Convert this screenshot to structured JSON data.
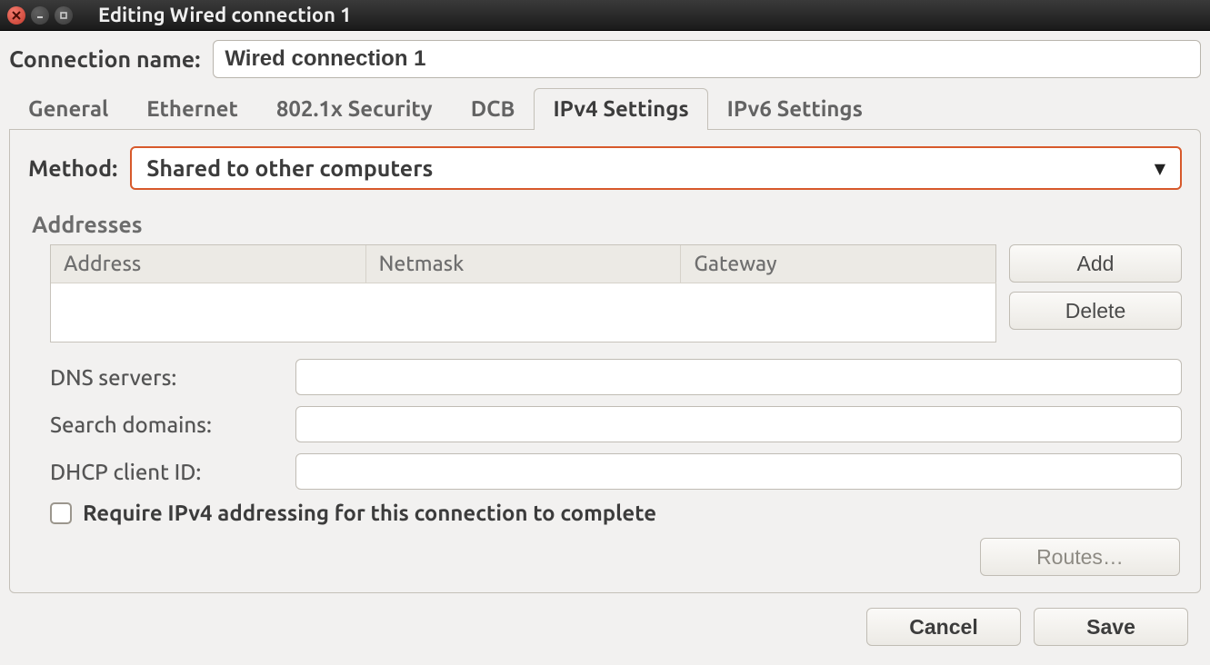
{
  "window": {
    "title": "Editing Wired connection 1"
  },
  "connection": {
    "name_label": "Connection name:",
    "name_value": "Wired connection 1"
  },
  "tabs": [
    {
      "label": "General"
    },
    {
      "label": "Ethernet"
    },
    {
      "label": "802.1x Security"
    },
    {
      "label": "DCB"
    },
    {
      "label": "IPv4 Settings"
    },
    {
      "label": "IPv6 Settings"
    }
  ],
  "active_tab_index": 4,
  "ipv4": {
    "method_label": "Method:",
    "method_value": "Shared to other computers",
    "addresses_section": "Addresses",
    "columns": {
      "address": "Address",
      "netmask": "Netmask",
      "gateway": "Gateway"
    },
    "buttons": {
      "add": "Add",
      "delete": "Delete"
    },
    "dns_label": "DNS servers:",
    "dns_value": "",
    "search_label": "Search domains:",
    "search_value": "",
    "dhcp_label": "DHCP client ID:",
    "dhcp_value": "",
    "require_label": "Require IPv4 addressing for this connection to complete",
    "require_checked": false,
    "routes_button": "Routes…"
  },
  "footer": {
    "cancel": "Cancel",
    "save": "Save"
  }
}
